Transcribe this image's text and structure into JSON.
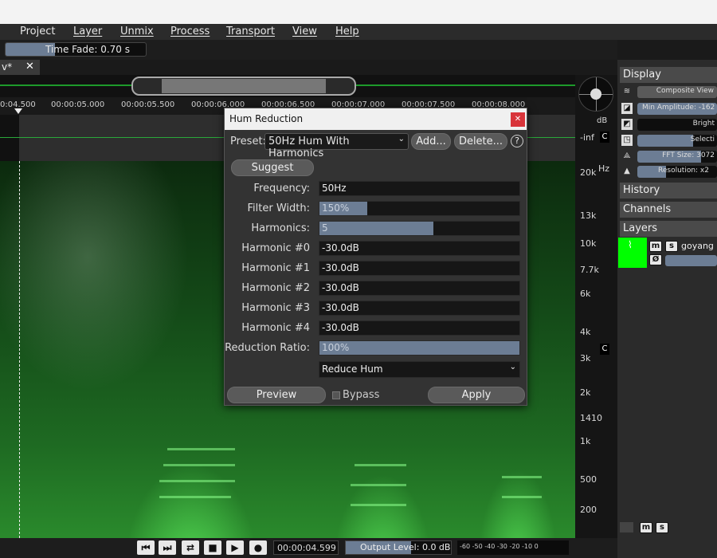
{
  "menu": {
    "project": "Project",
    "layer": "Layer",
    "unmix": "Unmix",
    "process": "Process",
    "transport": "Transport",
    "view": "View",
    "help": "Help"
  },
  "toolbar": {
    "time_fade": "Time Fade: 0.70 s"
  },
  "tab": {
    "label": "v*",
    "close": "✕"
  },
  "ruler": {
    "ticks": [
      "0:04.500",
      "00:00:05.000",
      "00:00:05.500",
      "00:00:06.000",
      "00:00:06.500",
      "00:00:07.000",
      "00:00:07.500",
      "00:00:08.000"
    ]
  },
  "axis": {
    "db": "dB",
    "inf": "-inf",
    "c_top": "C",
    "c_mid": "C",
    "hz": "Hz",
    "labels": [
      "20k",
      "13k",
      "10k",
      "7.7k",
      "6k",
      "4k",
      "3k",
      "2k",
      "1410",
      "1k",
      "500",
      "200"
    ]
  },
  "transport": {
    "time": "00:00:04.599",
    "output_level": "Output Level: 0.0 dB",
    "output_level_fraction": 0.62,
    "meter_scale": "-60  -50  -40  -30  -20  -10   0",
    "buttons": [
      "skip-back",
      "skip-forward",
      "loop",
      "stop",
      "play",
      "record"
    ]
  },
  "right_panel": {
    "display": "Display",
    "composite_view": "Composite View",
    "min_amplitude": "Min Amplitude: -162",
    "brightness": "Bright",
    "selection": "Selecti",
    "fft_size": "FFT Size: 3072",
    "resolution": "Resolution: x2",
    "history": "History",
    "channels": "Channels",
    "layers": "Layers",
    "layer_name": "goyang",
    "m": "m",
    "s": "s",
    "phase": "Ø"
  },
  "dialog": {
    "title": "Hum Reduction",
    "close": "✕",
    "preset_label": "Preset:",
    "preset_value": "50Hz Hum With Harmonics",
    "add_button": "Add...",
    "delete_button": "Delete...",
    "help": "?",
    "suggest_button": "Suggest",
    "fields": [
      {
        "label": "Frequency:",
        "value": "50Hz",
        "fraction": 0
      },
      {
        "label": "Filter Width:",
        "value": "150%",
        "fraction": 0.24
      },
      {
        "label": "Harmonics:",
        "value": "5",
        "fraction": 0.57
      },
      {
        "label": "Harmonic #0",
        "value": "-30.0dB",
        "fraction": 0
      },
      {
        "label": "Harmonic #1",
        "value": "-30.0dB",
        "fraction": 0
      },
      {
        "label": "Harmonic #2",
        "value": "-30.0dB",
        "fraction": 0
      },
      {
        "label": "Harmonic #3",
        "value": "-30.0dB",
        "fraction": 0
      },
      {
        "label": "Harmonic #4",
        "value": "-30.0dB",
        "fraction": 0
      },
      {
        "label": "Reduction Ratio:",
        "value": "100%",
        "fraction": 1.0
      }
    ],
    "mode_value": "Reduce Hum",
    "preview_button": "Preview",
    "bypass_label": "Bypass",
    "apply_button": "Apply"
  },
  "colors": {
    "accent": "#6c7d94",
    "waveform": "#1d9a2a",
    "layer_thumb": "#00ff00",
    "close_red": "#d8343a"
  }
}
